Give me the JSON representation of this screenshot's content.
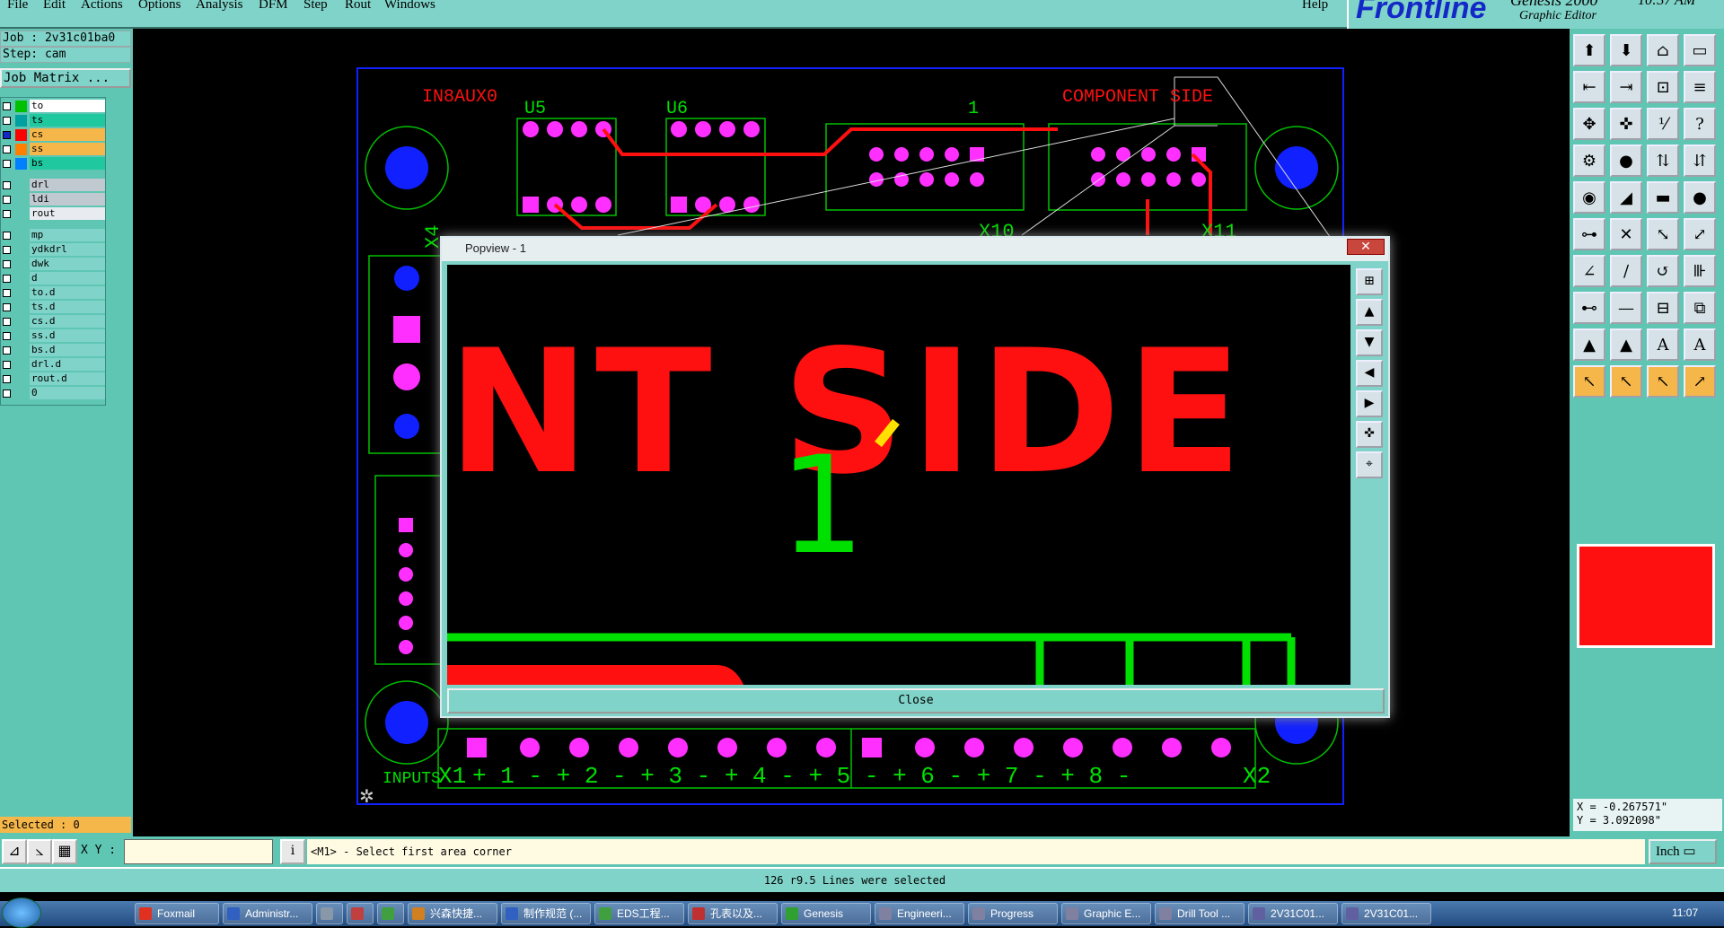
{
  "menubar": {
    "items": [
      "File",
      "Edit",
      "Actions",
      "Options",
      "Analysis",
      "DFM",
      "Step",
      "Rout",
      "Windows"
    ],
    "help": "Help"
  },
  "brand": {
    "logo_text": "Frontline",
    "product": "Genesis 2000",
    "subtitle": "Graphic Editor",
    "clock": "10:37 AM"
  },
  "job_panel": {
    "job": "Job : 2v31c01ba0",
    "step": "Step: cam",
    "matrix_button": "Job Matrix ...",
    "layers": [
      {
        "name": "to",
        "color": "#00c000",
        "checked": false,
        "bg": "#ffffff"
      },
      {
        "name": "ts",
        "color": "#00a0a0",
        "checked": false,
        "bg": "#20c8a0"
      },
      {
        "name": "cs",
        "color": "#ff0000",
        "checked": true,
        "bg": "#f5b64a"
      },
      {
        "name": "ss",
        "color": "#ff8000",
        "checked": false,
        "bg": "#f5b64a"
      },
      {
        "name": "bs",
        "color": "#0080ff",
        "checked": false,
        "bg": "#20c8a0"
      },
      {
        "name": "drl",
        "color": "",
        "checked": false,
        "bg": "#c0c8d0"
      },
      {
        "name": "ldi",
        "color": "",
        "checked": false,
        "bg": "#c0c8d0"
      },
      {
        "name": "rout",
        "color": "",
        "checked": false,
        "bg": "#e8ecf0"
      },
      {
        "name": "mp",
        "color": "",
        "checked": false,
        "bg": "#7fd3c8"
      },
      {
        "name": "ydkdrl",
        "color": "",
        "checked": false,
        "bg": "#7fd3c8"
      },
      {
        "name": "dwk",
        "color": "",
        "checked": false,
        "bg": "#7fd3c8"
      },
      {
        "name": "d",
        "color": "",
        "checked": false,
        "bg": "#7fd3c8"
      },
      {
        "name": "to.d",
        "color": "",
        "checked": false,
        "bg": "#7fd3c8"
      },
      {
        "name": "ts.d",
        "color": "",
        "checked": false,
        "bg": "#7fd3c8"
      },
      {
        "name": "cs.d",
        "color": "",
        "checked": false,
        "bg": "#7fd3c8"
      },
      {
        "name": "ss.d",
        "color": "",
        "checked": false,
        "bg": "#7fd3c8"
      },
      {
        "name": "bs.d",
        "color": "",
        "checked": false,
        "bg": "#7fd3c8"
      },
      {
        "name": "drl.d",
        "color": "",
        "checked": false,
        "bg": "#7fd3c8"
      },
      {
        "name": "rout.d",
        "color": "",
        "checked": false,
        "bg": "#7fd3c8"
      },
      {
        "name": "0",
        "color": "",
        "checked": false,
        "bg": "#7fd3c8"
      }
    ],
    "selected": "Selected : 0"
  },
  "board": {
    "labels": {
      "in8aux0": "IN8AUX0",
      "u5": "U5",
      "u6": "U6",
      "one": "1",
      "component_side": "COMPONENT SIDE",
      "x10": "X10",
      "x11": "X11",
      "x4": "X4",
      "inputs": "INPUTS",
      "x1": "X1",
      "x2": "X2",
      "terminal_labels": "+ 1 -   + 2 -   + 3 -   + 4 -   + 5 -   + 6 -   + 7 -   + 8 -"
    }
  },
  "popup": {
    "title": "Popview - 1",
    "close_label": "Close",
    "zoom_text": "NT SIDE",
    "zoom_one": "1"
  },
  "rightpanel": {
    "coords_x": "X = -0.267571\"",
    "coords_y": "Y = 3.092098\""
  },
  "cmdbar": {
    "xy_label": "X Y :",
    "xy_value": "",
    "prompt": "<M1> - Select first area corner",
    "unit": "Inch"
  },
  "status": {
    "message": "126 r9.5 Lines were selected"
  },
  "taskbar": {
    "items": [
      "Foxmail",
      "Administr...",
      "",
      "",
      "",
      "兴森快捷...",
      "制作规范 (...",
      "EDS工程...",
      "孔表以及...",
      "Genesis",
      "Engineeri...",
      "Progress",
      "Graphic E...",
      "Drill Tool ...",
      "2V31C01...",
      "2V31C01..."
    ],
    "time": "11:07"
  },
  "colors": {
    "accent": "#7fd3c8",
    "board_red": "#ff1010",
    "board_green": "#00e000",
    "pad_magenta": "#ff30ff",
    "hole_blue": "#1020ff"
  }
}
